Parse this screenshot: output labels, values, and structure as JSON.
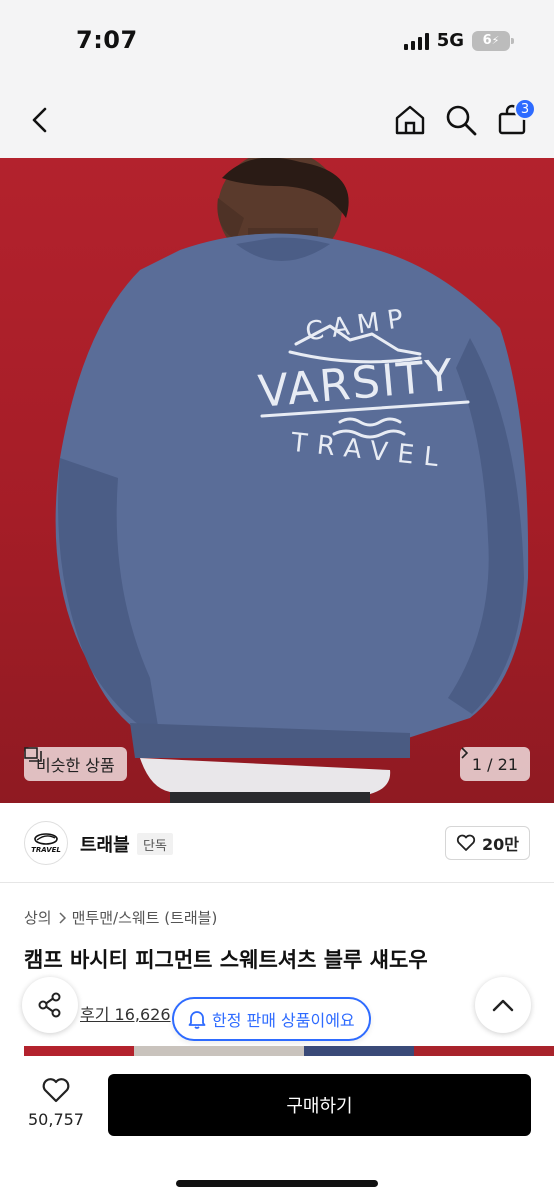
{
  "status_bar": {
    "time": "7:07",
    "network": "5G",
    "battery": "6"
  },
  "header": {
    "back_icon": "chevron-left-icon",
    "home_icon": "home-icon",
    "search_icon": "search-icon",
    "cart_icon": "shopping-bag-icon",
    "cart_count": "3"
  },
  "product_image": {
    "print_lines": [
      "CAMP",
      "VARSITY",
      "TRAVEL"
    ],
    "similar_label": "비슷한 상품",
    "page_counter": "1 / 21"
  },
  "brand": {
    "logo_text": "TRAVEL",
    "name": "트래블",
    "badge": "단독",
    "like_count": "20만"
  },
  "breadcrumb": {
    "level1": "상의",
    "level2": "맨투맨/스웨트 (트래블)"
  },
  "product": {
    "title": "캠프 바시티 피그먼트 스웨트셔츠 블루 섀도우",
    "reviews": "후기 16,626"
  },
  "notice_chip": {
    "label": "한정 판매 상품이에요"
  },
  "bottom_bar": {
    "wish_count": "50,757",
    "buy_label": "구매하기"
  },
  "colors": {
    "accent": "#2e6bff",
    "background_red": "#b3222d",
    "sweatshirt": "#5a6d98",
    "buy_button": "#000000"
  }
}
